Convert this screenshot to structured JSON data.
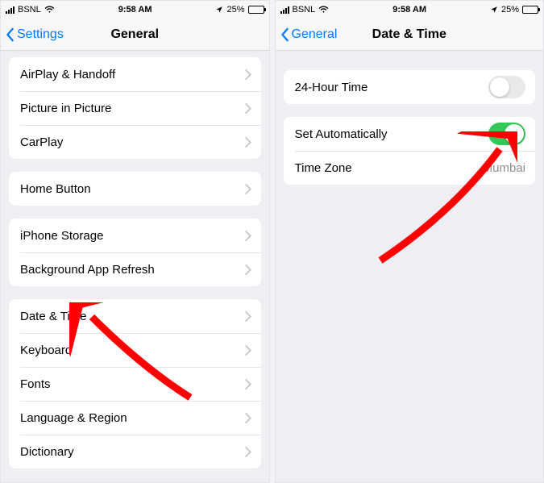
{
  "statusbar": {
    "carrier": "BSNL",
    "time": "9:58 AM",
    "battery_pct": "25%"
  },
  "left_screen": {
    "back_label": "Settings",
    "title": "General",
    "group1": {
      "airplay": "AirPlay & Handoff",
      "pip": "Picture in Picture",
      "carplay": "CarPlay"
    },
    "group2": {
      "home_button": "Home Button"
    },
    "group3": {
      "iphone_storage": "iPhone Storage",
      "bg_app_refresh": "Background App Refresh"
    },
    "group4": {
      "date_time": "Date & Time",
      "keyboard": "Keyboard",
      "fonts": "Fonts",
      "lang_region": "Language & Region",
      "dictionary": "Dictionary"
    }
  },
  "right_screen": {
    "back_label": "General",
    "title": "Date & Time",
    "group1": {
      "hour24": "24-Hour Time"
    },
    "group2": {
      "set_auto": "Set Automatically",
      "timezone_label": "Time Zone",
      "timezone_value": "Mumbai"
    }
  }
}
